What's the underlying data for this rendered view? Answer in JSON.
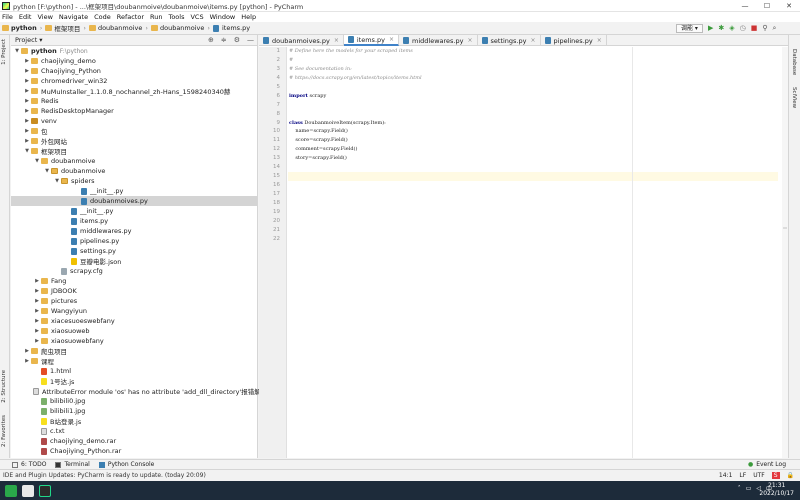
{
  "window": {
    "title": "python [F:\\python] - ...\\框架项目\\doubanmoive\\doubanmoive\\items.py [python] - PyCharm",
    "controls": [
      "—",
      "☐",
      "✕"
    ]
  },
  "menu": [
    "File",
    "Edit",
    "View",
    "Navigate",
    "Code",
    "Refactor",
    "Run",
    "Tools",
    "VCS",
    "Window",
    "Help"
  ],
  "breadcrumb": [
    "python",
    "框架项目",
    "doubanmoive",
    "doubanmoive",
    "items.py"
  ],
  "run_config": "调能 ▾",
  "project_panel": {
    "title": "Project ▾",
    "tree": [
      {
        "label": "python",
        "path": "F:\\python",
        "icon": "folder",
        "depth": 0,
        "arrow": "▼",
        "bold": true
      },
      {
        "label": "chaojiying_demo",
        "icon": "folder",
        "depth": 1,
        "arrow": "▶"
      },
      {
        "label": "Chaojiying_Python",
        "icon": "folder",
        "depth": 1,
        "arrow": "▶"
      },
      {
        "label": "chromedriver_win32",
        "icon": "folder",
        "depth": 1,
        "arrow": "▶"
      },
      {
        "label": "MuMuInstaller_1.1.0.8_nochannel_zh-Hans_1598240340赫",
        "icon": "folder",
        "depth": 1,
        "arrow": "▶"
      },
      {
        "label": "Redis",
        "icon": "folder",
        "depth": 1,
        "arrow": "▶"
      },
      {
        "label": "RedisDesktopManager",
        "icon": "folder",
        "depth": 1,
        "arrow": "▶"
      },
      {
        "label": "venv",
        "icon": "venv",
        "depth": 1,
        "arrow": "▶"
      },
      {
        "label": "包",
        "icon": "folder",
        "depth": 1,
        "arrow": "▶"
      },
      {
        "label": "外包网站",
        "icon": "folder",
        "depth": 1,
        "arrow": "▶"
      },
      {
        "label": "框架项目",
        "icon": "folder",
        "depth": 1,
        "arrow": "▼"
      },
      {
        "label": "doubanmoive",
        "icon": "folder",
        "depth": 2,
        "arrow": "▼"
      },
      {
        "label": "doubanmoive",
        "icon": "pkg",
        "depth": 3,
        "arrow": "▼"
      },
      {
        "label": "spiders",
        "icon": "pkg",
        "depth": 4,
        "arrow": "▼"
      },
      {
        "label": "__init__.py",
        "icon": "py",
        "depth": 6,
        "arrow": ""
      },
      {
        "label": "doubanmoives.py",
        "icon": "py",
        "depth": 6,
        "arrow": "",
        "selected": true
      },
      {
        "label": "__init__.py",
        "icon": "py",
        "depth": 5,
        "arrow": ""
      },
      {
        "label": "items.py",
        "icon": "py",
        "depth": 5,
        "arrow": ""
      },
      {
        "label": "middlewares.py",
        "icon": "py",
        "depth": 5,
        "arrow": ""
      },
      {
        "label": "pipelines.py",
        "icon": "py",
        "depth": 5,
        "arrow": ""
      },
      {
        "label": "settings.py",
        "icon": "py",
        "depth": 5,
        "arrow": ""
      },
      {
        "label": "豆瓣电影.json",
        "icon": "json",
        "depth": 5,
        "arrow": ""
      },
      {
        "label": "scrapy.cfg",
        "icon": "cfg",
        "depth": 4,
        "arrow": ""
      },
      {
        "label": "Fang",
        "icon": "folder",
        "depth": 2,
        "arrow": "▶"
      },
      {
        "label": "JDBOOK",
        "icon": "folder",
        "depth": 2,
        "arrow": "▶"
      },
      {
        "label": "pictures",
        "icon": "folder",
        "depth": 2,
        "arrow": "▶"
      },
      {
        "label": "Wangyiyun",
        "icon": "folder",
        "depth": 2,
        "arrow": "▶"
      },
      {
        "label": "xiacesuoeswebfany",
        "icon": "folder",
        "depth": 2,
        "arrow": "▶"
      },
      {
        "label": "xiaosuoweb",
        "icon": "folder",
        "depth": 2,
        "arrow": "▶"
      },
      {
        "label": "xiaosuowebfany",
        "icon": "folder",
        "depth": 2,
        "arrow": "▶"
      },
      {
        "label": "爬虫项目",
        "icon": "folder",
        "depth": 1,
        "arrow": "▶"
      },
      {
        "label": "课程",
        "icon": "folder",
        "depth": 1,
        "arrow": "▶"
      },
      {
        "label": "1.html",
        "icon": "html",
        "depth": 2,
        "arrow": ""
      },
      {
        "label": "1号达.js",
        "icon": "js",
        "depth": 2,
        "arrow": ""
      },
      {
        "label": "AttributeError module 'os' has no attribute 'add_dll_directory'报错解决方法.txt",
        "icon": "txt",
        "depth": 2,
        "arrow": ""
      },
      {
        "label": "bilibili0.jpg",
        "icon": "img",
        "depth": 2,
        "arrow": ""
      },
      {
        "label": "bilibili1.jpg",
        "icon": "img",
        "depth": 2,
        "arrow": ""
      },
      {
        "label": "B站登录.js",
        "icon": "js",
        "depth": 2,
        "arrow": ""
      },
      {
        "label": "c.txt",
        "icon": "txt",
        "depth": 2,
        "arrow": ""
      },
      {
        "label": "chaojiying_demo.rar",
        "icon": "rar",
        "depth": 2,
        "arrow": ""
      },
      {
        "label": "Chaojiying_Python.rar",
        "icon": "rar",
        "depth": 2,
        "arrow": ""
      }
    ]
  },
  "left_strip": [
    "1: Project",
    "2: Structure",
    "2: Favorites"
  ],
  "right_strip": [
    "Database",
    "SciView"
  ],
  "editor_tabs": [
    {
      "label": "doubanmoives.py",
      "active": false
    },
    {
      "label": "items.py",
      "active": true
    },
    {
      "label": "middlewares.py",
      "active": false
    },
    {
      "label": "settings.py",
      "active": false
    },
    {
      "label": "pipelines.py",
      "active": false
    }
  ],
  "code_lines": [
    {
      "text": "# Define here the models for your scraped items",
      "type": "comment"
    },
    {
      "text": "#",
      "type": "comment"
    },
    {
      "text": "# See documentation in:",
      "type": "comment"
    },
    {
      "text": "# https://docs.scrapy.org/en/latest/topics/items.html",
      "type": "comment"
    },
    {
      "text": "",
      "type": "plain"
    },
    {
      "text": "import scrapy",
      "type": "import"
    },
    {
      "text": "",
      "type": "plain"
    },
    {
      "text": "",
      "type": "plain"
    },
    {
      "text": "class DoubanmoiveItem(scrapy.Item):",
      "type": "class"
    },
    {
      "text": "    name=scrapy.Field()",
      "type": "plain"
    },
    {
      "text": "    score=scrapy.Field()",
      "type": "plain"
    },
    {
      "text": "    comment=scrapy.Field()",
      "type": "plain"
    },
    {
      "text": "    story=scrapy.Field()",
      "type": "plain"
    },
    {
      "text": "",
      "type": "plain"
    },
    {
      "text": "",
      "type": "current"
    },
    {
      "text": "",
      "type": "plain"
    },
    {
      "text": "",
      "type": "plain"
    },
    {
      "text": "",
      "type": "plain"
    },
    {
      "text": "",
      "type": "plain"
    },
    {
      "text": "",
      "type": "plain"
    },
    {
      "text": "",
      "type": "plain"
    },
    {
      "text": "",
      "type": "plain"
    }
  ],
  "bottom_tabs": [
    "6: TODO",
    "Terminal",
    "Python Console"
  ],
  "event_log": "Event Log",
  "status": {
    "message": "IDE and Plugin Updates: PyCharm is ready to update. (today 20:09)",
    "position": "14:1",
    "line_sep": "LF",
    "encoding": "UTF"
  },
  "clock": {
    "time": "21:31",
    "date": "2022/10/17"
  },
  "colors": {
    "accent": "#4083c9",
    "taskbar": "#1d2b3a",
    "comment": "#8c8c8c",
    "keyword": "#000080"
  }
}
